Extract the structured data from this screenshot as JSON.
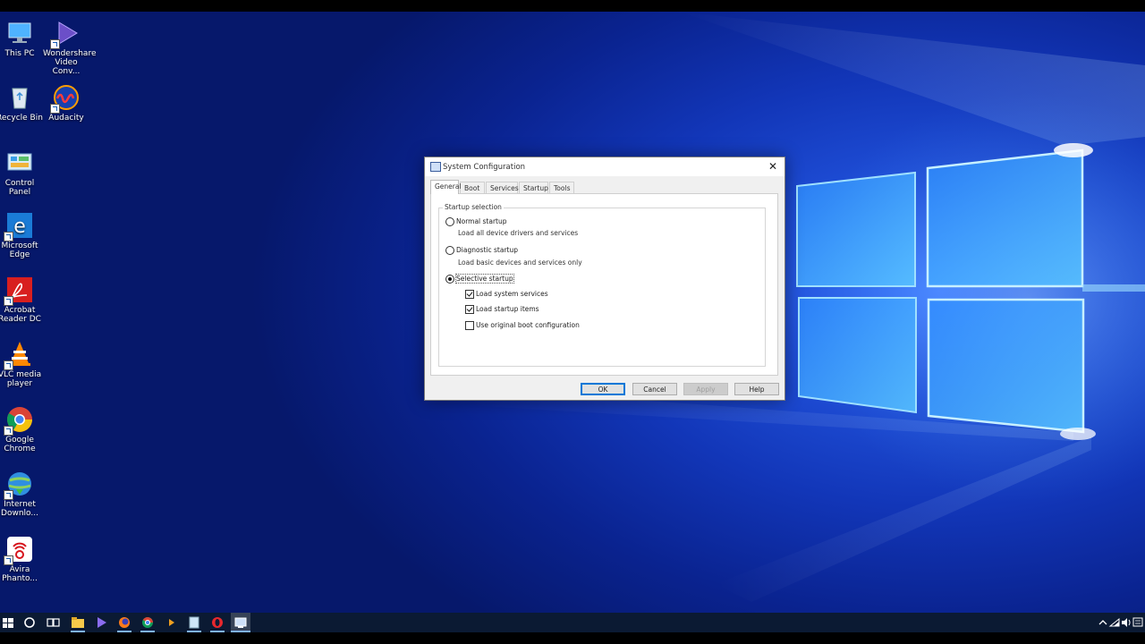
{
  "desktop_icons": [
    {
      "name": "this-pc",
      "label": "This PC",
      "icon": "computer-icon",
      "shortcut": false
    },
    {
      "name": "wondershare",
      "label": "Wondershare Video Conv...",
      "icon": "wondershare-play-icon",
      "shortcut": true
    },
    {
      "name": "recycle-bin",
      "label": "Recycle Bin",
      "icon": "recycle-bin-icon",
      "shortcut": false
    },
    {
      "name": "audacity",
      "label": "Audacity",
      "icon": "audacity-icon",
      "shortcut": true
    },
    {
      "name": "control-panel",
      "label": "Control Panel",
      "icon": "control-panel-icon",
      "shortcut": false
    },
    {
      "name": "edge",
      "label": "Microsoft Edge",
      "icon": "edge-icon",
      "shortcut": true
    },
    {
      "name": "acrobat",
      "label": "Acrobat Reader DC",
      "icon": "acrobat-icon",
      "shortcut": true
    },
    {
      "name": "vlc",
      "label": "VLC media player",
      "icon": "vlc-cone-icon",
      "shortcut": true
    },
    {
      "name": "chrome",
      "label": "Google Chrome",
      "icon": "chrome-icon",
      "shortcut": true
    },
    {
      "name": "idm",
      "label": "Internet Downlo...",
      "icon": "idm-globe-icon",
      "shortcut": true
    },
    {
      "name": "avira",
      "label": "Avira Phanto...",
      "icon": "avira-icon",
      "shortcut": true
    }
  ],
  "dialog": {
    "title": "System Configuration",
    "tabs": [
      "General",
      "Boot",
      "Services",
      "Startup",
      "Tools"
    ],
    "active_tab": "General",
    "group_label": "Startup selection",
    "options": {
      "normal": {
        "label": "Normal startup",
        "desc": "Load all device drivers and services",
        "selected": false
      },
      "diagnostic": {
        "label": "Diagnostic startup",
        "desc": "Load basic devices and services only",
        "selected": false
      },
      "selective": {
        "label": "Selective startup",
        "selected": true
      }
    },
    "checkboxes": [
      {
        "label": "Load system services",
        "checked": true
      },
      {
        "label": "Load startup items",
        "checked": true
      },
      {
        "label": "Use original boot configuration",
        "checked": false
      }
    ],
    "buttons": {
      "ok": "OK",
      "cancel": "Cancel",
      "apply": "Apply",
      "help": "Help"
    }
  },
  "taskbar": {
    "items": [
      "start-windows-icon",
      "cortana-circle-icon",
      "task-view-icon",
      "file-explorer-icon",
      "wondershare-icon",
      "firefox-icon",
      "chrome-icon",
      "media-player-icon",
      "notepad-icon",
      "opera-icon",
      "system-configuration-icon"
    ],
    "active_item": "system-configuration-icon",
    "tray": [
      "chevron-up-icon",
      "network-icon",
      "volume-icon",
      "notifications-icon"
    ]
  },
  "colors": {
    "accent": "#0078d7",
    "taskbar": "#0b1a33",
    "desktop": "#1236b8"
  }
}
